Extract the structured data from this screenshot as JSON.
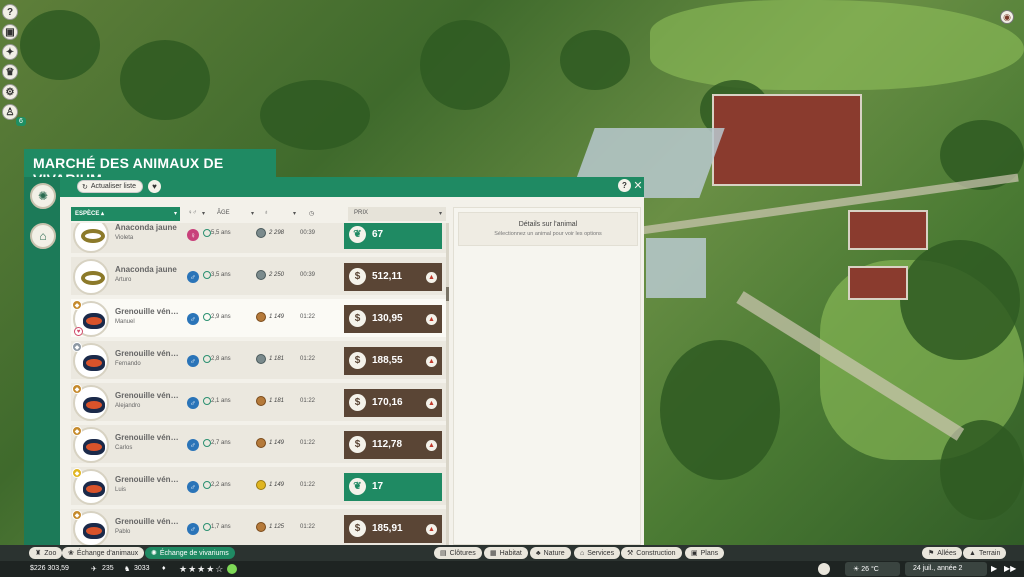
{
  "panel": {
    "title": "MARCHÉ DES ANIMAUX DE VIVARIUM",
    "refresh_label": "Actualiser liste",
    "heart_icon": "♥",
    "help_label": "?",
    "close_label": "✕"
  },
  "columns": {
    "species": "ESPÈCE ▴",
    "age": "ÂGE",
    "price": "PRIX"
  },
  "details": {
    "title": "Détails sur l'animal",
    "hint": "Sélectionnez un animal pour voir les options"
  },
  "rows": [
    {
      "name": "Anaconda jaune",
      "sub": "Violeta",
      "sex": "♀",
      "age": "5,5 ans",
      "rel": "2 298",
      "time": "00:39",
      "price": "67",
      "price_type": "green",
      "rank": "",
      "fav": false
    },
    {
      "name": "Anaconda jaune",
      "sub": "Arturo",
      "sex": "♂",
      "age": "3,5 ans",
      "rel": "2 250",
      "time": "00:39",
      "price": "512,11",
      "price_type": "brown",
      "rank": "",
      "fav": false
    },
    {
      "name": "Grenouille vén…",
      "sub": "Manuel",
      "sex": "♂",
      "age": "2,9 ans",
      "rel": "1 149",
      "time": "01:22",
      "price": "130,95",
      "price_type": "brown",
      "rank": "bronze",
      "fav": true
    },
    {
      "name": "Grenouille vén…",
      "sub": "Fernando",
      "sex": "♂",
      "age": "2,8 ans",
      "rel": "1 181",
      "time": "01:22",
      "price": "188,55",
      "price_type": "brown",
      "rank": "silver",
      "fav": false
    },
    {
      "name": "Grenouille vén…",
      "sub": "Alejandro",
      "sex": "♂",
      "age": "2,1 ans",
      "rel": "1 181",
      "time": "01:22",
      "price": "170,16",
      "price_type": "brown",
      "rank": "bronze",
      "fav": false
    },
    {
      "name": "Grenouille vén…",
      "sub": "Carlos",
      "sex": "♂",
      "age": "2,7 ans",
      "rel": "1 149",
      "time": "01:22",
      "price": "112,78",
      "price_type": "brown",
      "rank": "bronze",
      "fav": false
    },
    {
      "name": "Grenouille vén…",
      "sub": "Luis",
      "sex": "♂",
      "age": "2,2 ans",
      "rel": "1 149",
      "time": "01:22",
      "price": "17",
      "price_type": "green",
      "rank": "gold",
      "fav": false
    },
    {
      "name": "Grenouille vén…",
      "sub": "Pablo",
      "sex": "♂",
      "age": "1,7 ans",
      "rel": "1 125",
      "time": "01:22",
      "price": "185,91",
      "price_type": "brown",
      "rank": "bronze",
      "fav": false
    }
  ],
  "tabs_left": [
    "Zoo",
    "Échange d'animaux",
    "Échange de vivariums"
  ],
  "tabs_mid": [
    "Clôtures",
    "Habitat",
    "Nature",
    "Services",
    "Construction",
    "Plans"
  ],
  "tabs_right": [
    "Allées",
    "Terrain"
  ],
  "status": {
    "money": "$226 303,59",
    "guests": "235",
    "animals": "3033",
    "stars": "★★★★☆",
    "temperature": "26 °C",
    "date": "24 juil., année 2"
  },
  "left_icons": [
    "help-icon",
    "zoo-icon",
    "awards-icon",
    "trophy-icon",
    "settings-icon",
    "staff-icon"
  ],
  "badge_count": "6",
  "colors": {
    "accent": "#1f8a63",
    "price_brown": "#5a4535"
  }
}
